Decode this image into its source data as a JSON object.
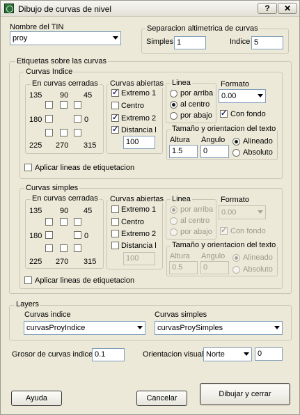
{
  "title": "Dibujo de curvas de nivel",
  "titlebar": {
    "help_glyph": "?",
    "close_glyph": "✕"
  },
  "tin": {
    "label": "Nombre del TIN",
    "selected": "proy"
  },
  "separacion": {
    "title": "Separacion altimetrica de curvas",
    "simples_label": "Simples",
    "simples_value": "1",
    "indice_label": "Indice",
    "indice_value": "5"
  },
  "etiquetas": {
    "title": "Etiquetas sobre las curvas",
    "indice": {
      "title": "Curvas Indice",
      "cerradas_title": "En curvas cerradas",
      "angles": [
        "135",
        "90",
        "45",
        "180",
        "0",
        "225",
        "270",
        "315"
      ],
      "abiertas_title": "Curvas abiertas",
      "extremo1": "Extremo 1",
      "centro": "Centro",
      "extremo2": "Extremo 2",
      "distancia": "Distancia l",
      "distancia_value": "100",
      "linea_title": "Linea",
      "por_arriba": "por arriba",
      "al_centro": "al centro",
      "por_abajo": "por abajo",
      "formato_title": "Formato",
      "formato_value": "0.00",
      "con_fondo": "Con fondo",
      "tamano_title": "Tamaño y orientacion del texto",
      "altura_label": "Altura",
      "altura_value": "1.5",
      "angulo_label": "Angulo",
      "angulo_value": "0",
      "alineado": "Alineado",
      "absoluto": "Absoluto",
      "aplicar": "Aplicar lineas de etiquetacion"
    },
    "simples": {
      "title": "Curvas simples",
      "cerradas_title": "En curvas cerradas",
      "angles": [
        "135",
        "90",
        "45",
        "180",
        "0",
        "225",
        "270",
        "315"
      ],
      "abiertas_title": "Curvas abiertas",
      "extremo1": "Extremo 1",
      "centro": "Centro",
      "extremo2": "Extremo 2",
      "distancia": "Distancia l",
      "distancia_value": "100",
      "linea_title": "Linea",
      "por_arriba": "por arriba",
      "al_centro": "al centro",
      "por_abajo": "por abajo",
      "formato_title": "Formato",
      "formato_value": "0.00",
      "con_fondo": "Con fondo",
      "tamano_title": "Tamaño y orientacion del texto",
      "altura_label": "Altura",
      "altura_value": "0.5",
      "angulo_label": "Angulo",
      "angulo_value": "0",
      "alineado": "Alineado",
      "absoluto": "Absoluto",
      "aplicar": "Aplicar lineas de etiquetacion"
    }
  },
  "layers": {
    "title": "Layers",
    "indice_label": "Curvas indice",
    "indice_value": "curvasProyIndice",
    "simples_label": "Curvas simples",
    "simples_value": "curvasProySimples"
  },
  "grosor": {
    "label": "Grosor de curvas indice",
    "value": "0.1"
  },
  "orientacion": {
    "label": "Orientacion visual",
    "selected": "Norte",
    "value": "0"
  },
  "buttons": {
    "ayuda": "Ayuda",
    "cancelar": "Cancelar",
    "dibujar": "Dibujar y cerrar"
  }
}
